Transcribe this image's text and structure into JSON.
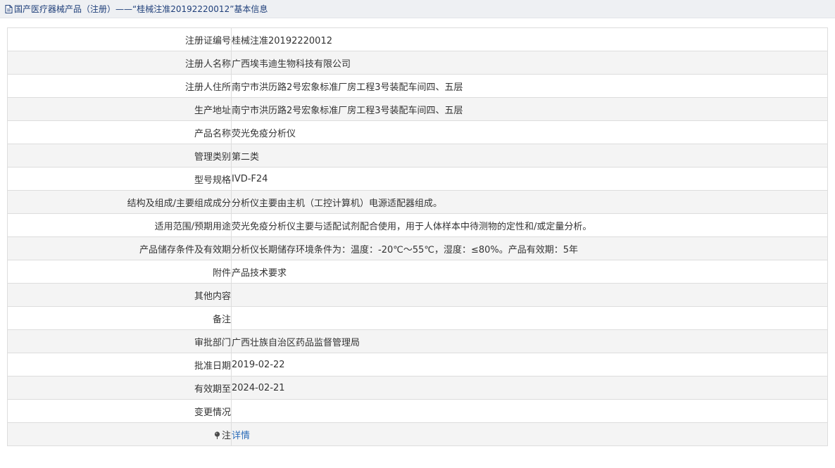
{
  "breadcrumb": {
    "icon": "document-icon",
    "text": "国产医疗器械产品（注册）——“桂械注准20192220012”基本信息"
  },
  "rows": [
    {
      "label": "注册证编号",
      "value": "桂械注准20192220012"
    },
    {
      "label": "注册人名称",
      "value": "广西埃韦迪生物科技有限公司"
    },
    {
      "label": "注册人住所",
      "value": "南宁市洪历路2号宏象标准厂房工程3号装配车间四、五层"
    },
    {
      "label": "生产地址",
      "value": "南宁市洪历路2号宏象标准厂房工程3号装配车间四、五层"
    },
    {
      "label": "产品名称",
      "value": "荧光免疫分析仪"
    },
    {
      "label": "管理类别",
      "value": "第二类"
    },
    {
      "label": "型号规格",
      "value": "IVD-F24"
    },
    {
      "label": "结构及组成/主要组成成分",
      "value": "分析仪主要由主机（工控计算机）电源适配器组成。"
    },
    {
      "label": "适用范围/预期用途",
      "value": "荧光免疫分析仪主要与适配试剂配合使用，用于人体样本中待测物的定性和/或定量分析。"
    },
    {
      "label": "产品储存条件及有效期",
      "value": "分析仪长期储存环境条件为：温度：-20℃～55℃，湿度：≤80%。产品有效期：5年"
    },
    {
      "label": "附件",
      "value": "产品技术要求"
    },
    {
      "label": "其他内容",
      "value": ""
    },
    {
      "label": "备注",
      "value": ""
    },
    {
      "label": "审批部门",
      "value": "广西壮族自治区药品监督管理局"
    },
    {
      "label": "批准日期",
      "value": "2019-02-22"
    },
    {
      "label": "有效期至",
      "value": "2024-02-21"
    },
    {
      "label": "变更情况",
      "value": ""
    }
  ],
  "note_row": {
    "icon": "pin-icon",
    "label": "注",
    "link_text": "详情"
  },
  "colors": {
    "link": "#2a6bb8",
    "breadcrumb_text": "#1f3f7a",
    "stripe": "#f4f4f4",
    "border": "#dddddd"
  }
}
